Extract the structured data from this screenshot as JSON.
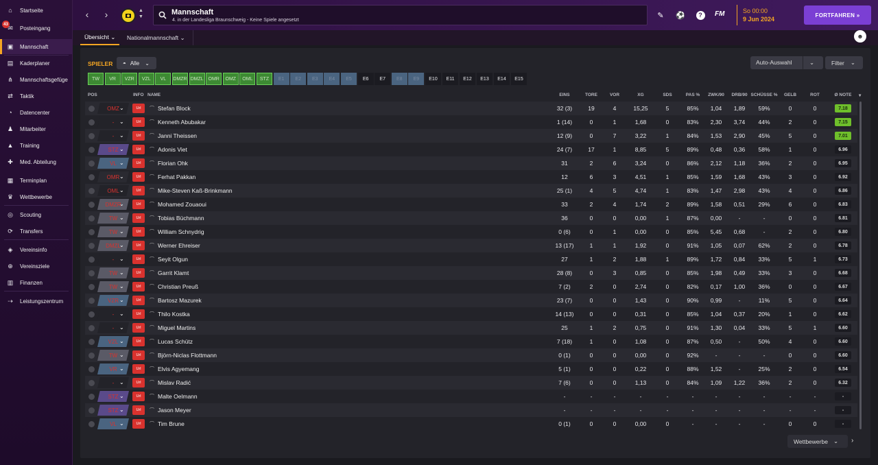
{
  "sidebar": {
    "badge_count": "43",
    "items": [
      {
        "label": "Startseite",
        "icon": "home-icon"
      },
      {
        "label": "Posteingang",
        "icon": "inbox-icon"
      },
      {
        "label": "Mannschaft",
        "icon": "shirt-icon",
        "active": true
      },
      {
        "label": "Kaderplaner",
        "icon": "clipboard-icon"
      },
      {
        "label": "Mannschaftsgefüge",
        "icon": "hierarchy-icon"
      },
      {
        "label": "Taktik",
        "icon": "tactics-icon"
      },
      {
        "label": "Datencenter",
        "icon": "data-icon"
      },
      {
        "label": "Mitarbeiter",
        "icon": "staff-icon"
      },
      {
        "label": "Training",
        "icon": "training-icon"
      },
      {
        "label": "Med. Abteilung",
        "icon": "medical-icon"
      },
      {
        "label": "Terminplan",
        "icon": "calendar-icon"
      },
      {
        "label": "Wettbewerbe",
        "icon": "trophy-icon"
      },
      {
        "label": "Scouting",
        "icon": "scouting-icon"
      },
      {
        "label": "Transfers",
        "icon": "transfer-icon"
      },
      {
        "label": "Vereinsinfo",
        "icon": "shield-icon"
      },
      {
        "label": "Vereinsziele",
        "icon": "target-icon"
      },
      {
        "label": "Finanzen",
        "icon": "finance-icon"
      },
      {
        "label": "Leistungszentrum",
        "icon": "academy-icon"
      }
    ]
  },
  "header": {
    "title": "Mannschaft",
    "subtitle": "4. in der Landesliga Braunschweig - Keine Spiele angesetzt",
    "fm_logo": "FM",
    "time": "So 00:00",
    "date": "9 Jun 2024",
    "continue_label": "FORTFAHREN »"
  },
  "subnav": {
    "tabs": [
      {
        "label": "Übersicht ⌄"
      },
      {
        "label": "Nationalmannschaft ⌄"
      }
    ]
  },
  "toolbar": {
    "spieler_label": "SPIELER",
    "alle_label": "Alle",
    "auto_label": "Auto-Auswahl",
    "filter_label": "Filter",
    "wettbewerbe_label": "Wettbewerbe"
  },
  "positions": [
    "TW",
    "VR",
    "VZR",
    "VZL",
    "VL",
    "DMZR",
    "DMZL",
    "OMR",
    "OMZ",
    "OML",
    "STZ",
    "E1",
    "E2",
    "E3",
    "E4",
    "E5",
    "E6",
    "E7",
    "E8",
    "E9",
    "E10",
    "E11",
    "E12",
    "E13",
    "E14",
    "E15"
  ],
  "table": {
    "headers": {
      "pos": "POS",
      "info": "INFO",
      "name": "NAME",
      "eins": "EINS",
      "tore": "TORE",
      "vor": "VOR",
      "xg": "XG",
      "sds": "SDS",
      "pas": "PAS %",
      "zwk": "ZWK/90",
      "drb": "DRB/90",
      "schuesse": "SCHÜSSE %",
      "gelb": "GELB",
      "rot": "ROT",
      "note": "Ø NOTE"
    },
    "rows": [
      {
        "pos": "OMZ",
        "pc": "#232329",
        "info": "Url",
        "name": "Stefan Block",
        "eins": "32 (3)",
        "tore": "19",
        "vor": "4",
        "xg": "15,25",
        "sds": "5",
        "pas": "85%",
        "zwk": "1,04",
        "drb": "1,89",
        "sch": "59%",
        "gelb": "0",
        "rot": "0",
        "note": "7.18",
        "ng": true
      },
      {
        "pos": "-",
        "pc": "#232329",
        "info": "Url",
        "name": "Kenneth Abubakar",
        "eins": "1 (14)",
        "tore": "0",
        "vor": "1",
        "xg": "1,68",
        "sds": "0",
        "pas": "83%",
        "zwk": "2,30",
        "drb": "3,74",
        "sch": "44%",
        "gelb": "2",
        "rot": "0",
        "note": "7.15",
        "ng": true
      },
      {
        "pos": "-",
        "pc": "#232329",
        "info": "Url",
        "name": "Janni Theissen",
        "eins": "12 (9)",
        "tore": "0",
        "vor": "7",
        "xg": "3,22",
        "sds": "1",
        "pas": "84%",
        "zwk": "1,53",
        "drb": "2,90",
        "sch": "45%",
        "gelb": "5",
        "rot": "0",
        "note": "7.01",
        "ng": true
      },
      {
        "pos": "STZ",
        "pc": "#5a4a8a",
        "info": "Url",
        "name": "Adonis Viet",
        "eins": "24 (7)",
        "tore": "17",
        "vor": "1",
        "xg": "8,85",
        "sds": "5",
        "pas": "89%",
        "zwk": "0,48",
        "drb": "0,36",
        "sch": "58%",
        "gelb": "1",
        "rot": "0",
        "note": "6.96",
        "ng": false
      },
      {
        "pos": "VL",
        "pc": "#4a6480",
        "info": "Url",
        "name": "Florian Ohk",
        "eins": "31",
        "tore": "2",
        "vor": "6",
        "xg": "3,24",
        "sds": "0",
        "pas": "86%",
        "zwk": "2,12",
        "drb": "1,18",
        "sch": "36%",
        "gelb": "2",
        "rot": "0",
        "note": "6.95",
        "ng": false
      },
      {
        "pos": "OMR",
        "pc": "#2a2a31",
        "info": "Url",
        "name": "Ferhat Pakkan",
        "eins": "12",
        "tore": "6",
        "vor": "3",
        "xg": "4,51",
        "sds": "1",
        "pas": "85%",
        "zwk": "1,59",
        "drb": "1,68",
        "sch": "43%",
        "gelb": "3",
        "rot": "0",
        "note": "6.92",
        "ng": false
      },
      {
        "pos": "OML",
        "pc": "#232329",
        "info": "Url",
        "name": "Mike-Steven Kaß-Brinkmann",
        "eins": "25 (1)",
        "tore": "4",
        "vor": "5",
        "xg": "4,74",
        "sds": "1",
        "pas": "83%",
        "zwk": "1,47",
        "drb": "2,98",
        "sch": "43%",
        "gelb": "4",
        "rot": "0",
        "note": "6.86",
        "ng": false
      },
      {
        "pos": "DMZR",
        "pc": "#5a5a66",
        "info": "Url",
        "name": "Mohamed Zouaoui",
        "eins": "33",
        "tore": "2",
        "vor": "4",
        "xg": "1,74",
        "sds": "2",
        "pas": "89%",
        "zwk": "1,58",
        "drb": "0,51",
        "sch": "29%",
        "gelb": "6",
        "rot": "0",
        "note": "6.83",
        "ng": false
      },
      {
        "pos": "TW",
        "pc": "#5a5a66",
        "info": "Url",
        "name": "Tobias Büchmann",
        "eins": "36",
        "tore": "0",
        "vor": "0",
        "xg": "0,00",
        "sds": "1",
        "pas": "87%",
        "zwk": "0,00",
        "drb": "-",
        "sch": "-",
        "gelb": "0",
        "rot": "0",
        "note": "6.81",
        "ng": false
      },
      {
        "pos": "TW",
        "pc": "#5a5a66",
        "info": "Url",
        "name": "William Schnydrig",
        "eins": "0 (6)",
        "tore": "0",
        "vor": "1",
        "xg": "0,00",
        "sds": "0",
        "pas": "85%",
        "zwk": "5,45",
        "drb": "0,68",
        "sch": "-",
        "gelb": "2",
        "rot": "0",
        "note": "6.80",
        "ng": false
      },
      {
        "pos": "DMZL",
        "pc": "#5a5a66",
        "info": "Url",
        "name": "Werner Ehreiser",
        "eins": "13 (17)",
        "tore": "1",
        "vor": "1",
        "xg": "1,92",
        "sds": "0",
        "pas": "91%",
        "zwk": "1,05",
        "drb": "0,07",
        "sch": "62%",
        "gelb": "2",
        "rot": "0",
        "note": "6.78",
        "ng": false
      },
      {
        "pos": "-",
        "pc": "#232329",
        "info": "Url",
        "name": "Seyit Olgun",
        "eins": "27",
        "tore": "1",
        "vor": "2",
        "xg": "1,88",
        "sds": "1",
        "pas": "89%",
        "zwk": "1,72",
        "drb": "0,84",
        "sch": "33%",
        "gelb": "5",
        "rot": "1",
        "note": "6.73",
        "ng": false
      },
      {
        "pos": "TW",
        "pc": "#5a5a66",
        "info": "Url",
        "name": "Garrit Klamt",
        "eins": "28 (8)",
        "tore": "0",
        "vor": "3",
        "xg": "0,85",
        "sds": "0",
        "pas": "85%",
        "zwk": "1,98",
        "drb": "0,49",
        "sch": "33%",
        "gelb": "3",
        "rot": "0",
        "note": "6.68",
        "ng": false
      },
      {
        "pos": "TW",
        "pc": "#5a5a66",
        "info": "Url",
        "name": "Christian Preuß",
        "eins": "7 (2)",
        "tore": "2",
        "vor": "0",
        "xg": "2,74",
        "sds": "0",
        "pas": "82%",
        "zwk": "0,17",
        "drb": "1,00",
        "sch": "36%",
        "gelb": "0",
        "rot": "0",
        "note": "6.67",
        "ng": false
      },
      {
        "pos": "VZR",
        "pc": "#4a6480",
        "info": "Url",
        "name": "Bartosz Mazurek",
        "eins": "23 (7)",
        "tore": "0",
        "vor": "0",
        "xg": "1,43",
        "sds": "0",
        "pas": "90%",
        "zwk": "0,99",
        "drb": "-",
        "sch": "11%",
        "gelb": "5",
        "rot": "0",
        "note": "6.64",
        "ng": false
      },
      {
        "pos": "-",
        "pc": "#232329",
        "info": "Url",
        "name": "Thilo Kostka",
        "eins": "14 (13)",
        "tore": "0",
        "vor": "0",
        "xg": "0,31",
        "sds": "0",
        "pas": "85%",
        "zwk": "1,04",
        "drb": "0,37",
        "sch": "20%",
        "gelb": "1",
        "rot": "0",
        "note": "6.62",
        "ng": false
      },
      {
        "pos": "-",
        "pc": "#232329",
        "info": "Url",
        "name": "Miguel Martins",
        "eins": "25",
        "tore": "1",
        "vor": "2",
        "xg": "0,75",
        "sds": "0",
        "pas": "91%",
        "zwk": "1,30",
        "drb": "0,04",
        "sch": "33%",
        "gelb": "5",
        "rot": "1",
        "note": "6.60",
        "ng": false
      },
      {
        "pos": "VZL",
        "pc": "#4a6480",
        "info": "Url",
        "name": "Lucas Schütz",
        "eins": "7 (18)",
        "tore": "1",
        "vor": "0",
        "xg": "1,08",
        "sds": "0",
        "pas": "87%",
        "zwk": "0,50",
        "drb": "-",
        "sch": "50%",
        "gelb": "4",
        "rot": "0",
        "note": "6.60",
        "ng": false
      },
      {
        "pos": "TW",
        "pc": "#5a5a66",
        "info": "Url",
        "name": "Björn-Niclas Flottmann",
        "eins": "0 (1)",
        "tore": "0",
        "vor": "0",
        "xg": "0,00",
        "sds": "0",
        "pas": "92%",
        "zwk": "-",
        "drb": "-",
        "sch": "-",
        "gelb": "0",
        "rot": "0",
        "note": "6.60",
        "ng": false
      },
      {
        "pos": "VR",
        "pc": "#4a6480",
        "info": "Url",
        "name": "Elvis Agyemang",
        "eins": "5 (1)",
        "tore": "0",
        "vor": "0",
        "xg": "0,22",
        "sds": "0",
        "pas": "88%",
        "zwk": "1,52",
        "drb": "-",
        "sch": "25%",
        "gelb": "2",
        "rot": "0",
        "note": "6.54",
        "ng": false
      },
      {
        "pos": "-",
        "pc": "#232329",
        "info": "Url",
        "name": "Mislav Radić",
        "eins": "7 (6)",
        "tore": "0",
        "vor": "0",
        "xg": "1,13",
        "sds": "0",
        "pas": "84%",
        "zwk": "1,09",
        "drb": "1,22",
        "sch": "36%",
        "gelb": "2",
        "rot": "0",
        "note": "6.32",
        "ng": false
      },
      {
        "pos": "STZ",
        "pc": "#5a4a8a",
        "info": "Url",
        "name": "Malte Oelmann",
        "eins": "-",
        "tore": "-",
        "vor": "-",
        "xg": "-",
        "sds": "-",
        "pas": "-",
        "zwk": "-",
        "drb": "-",
        "sch": "-",
        "gelb": "-",
        "rot": "-",
        "note": "-",
        "ng": false
      },
      {
        "pos": "STZ",
        "pc": "#5a4a8a",
        "info": "Url",
        "name": "Jason Meyer",
        "eins": "-",
        "tore": "-",
        "vor": "-",
        "xg": "-",
        "sds": "-",
        "pas": "-",
        "zwk": "-",
        "drb": "-",
        "sch": "-",
        "gelb": "-",
        "rot": "-",
        "note": "-",
        "ng": false
      },
      {
        "pos": "VL",
        "pc": "#4a6480",
        "info": "Url",
        "name": "Tim Brune",
        "eins": "0 (1)",
        "tore": "0",
        "vor": "0",
        "xg": "0,00",
        "sds": "0",
        "pas": "-",
        "zwk": "-",
        "drb": "-",
        "sch": "-",
        "gelb": "0",
        "rot": "0",
        "note": "-",
        "ng": false
      }
    ]
  },
  "colors": {
    "accent": "#f5a623",
    "brand": "#7b3fd4",
    "note_green": "#6fbf2b",
    "pos_text": "#d9322e"
  }
}
